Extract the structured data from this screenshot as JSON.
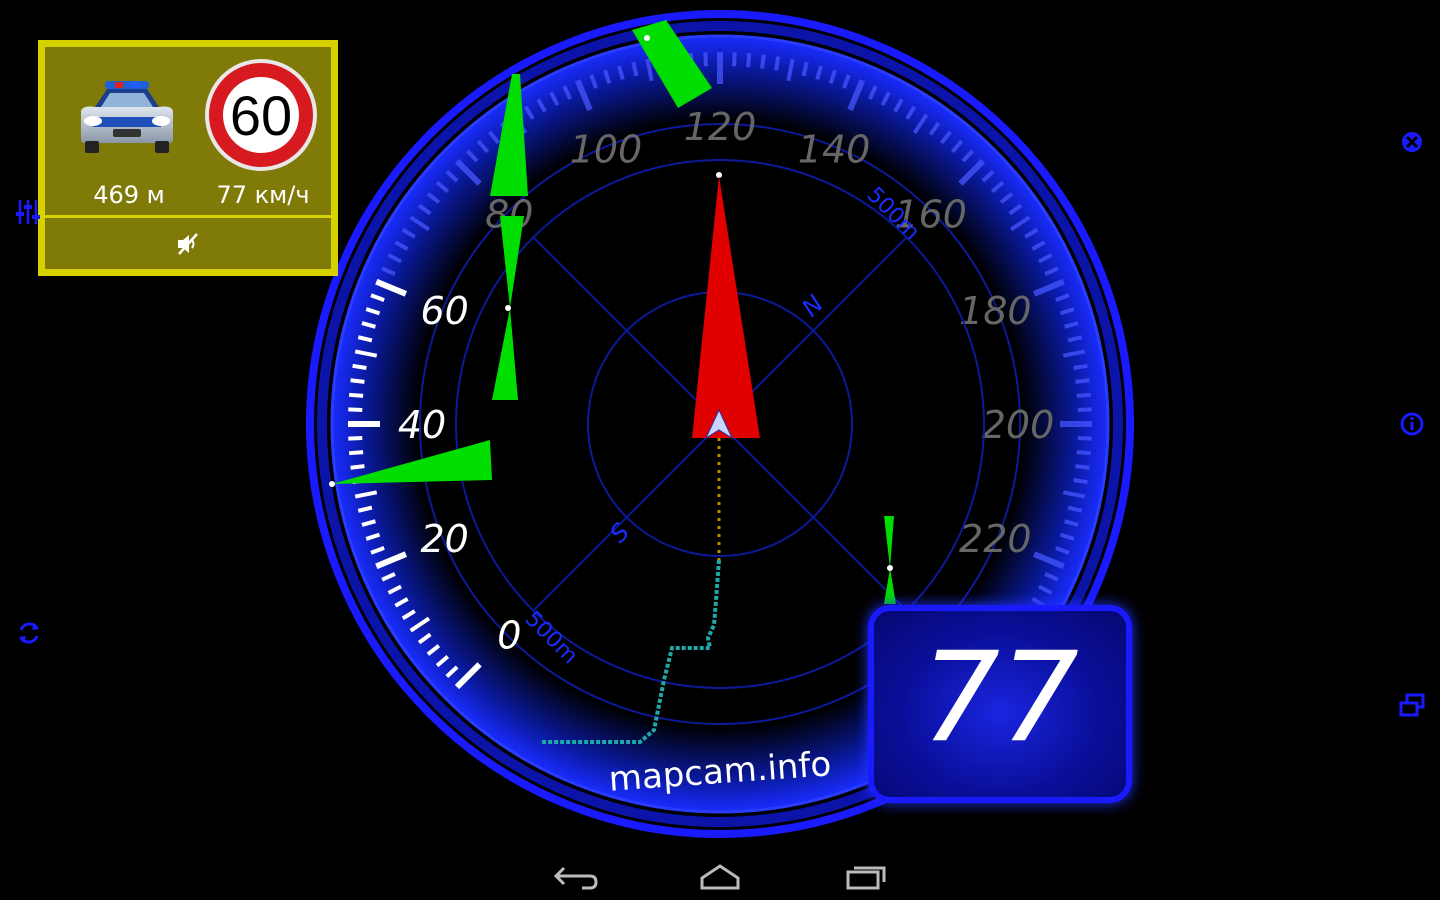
{
  "alert": {
    "distance": "469 м",
    "camera_speed": "77 км/ч",
    "speed_limit": "60",
    "camera_icon": "police-car-icon",
    "mute_icon": "volume-mute-icon",
    "colors": {
      "frame": "#d7d100",
      "panel": "#807b08"
    }
  },
  "gauge": {
    "speed_marks": [
      "0",
      "20",
      "40",
      "60",
      "80",
      "100",
      "120",
      "140",
      "160",
      "180",
      "200",
      "220"
    ],
    "compass_north": "N",
    "compass_south": "S",
    "range_label_top": "500m",
    "range_label_bottom": "500m",
    "colors": {
      "ring": "#1a1aff",
      "heading_arrow": "#e00000",
      "track": "#1fa8a8",
      "camera_zone": "#00dd00"
    }
  },
  "speed_display": {
    "value": "77"
  },
  "brand": "mapcam.info",
  "side_controls": {
    "left": [
      "equalizer-icon",
      "refresh-icon"
    ],
    "right": [
      "close-icon",
      "info-icon",
      "windows-icon"
    ]
  },
  "nav_bar": [
    "back-icon",
    "home-icon",
    "recent-apps-icon"
  ]
}
